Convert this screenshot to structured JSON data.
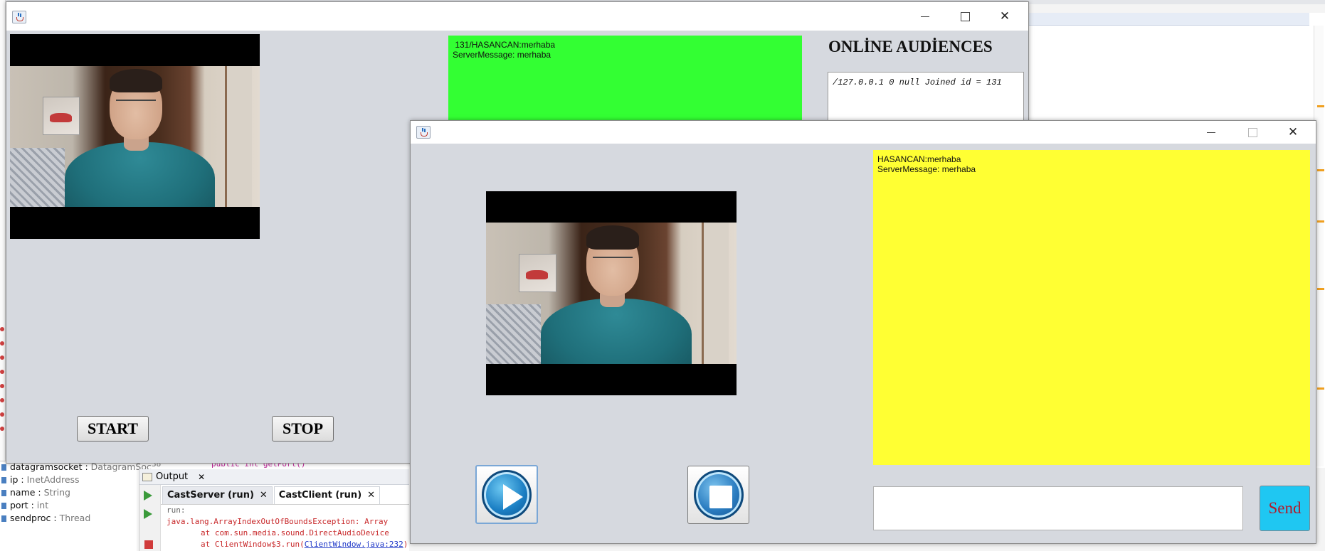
{
  "ide": {
    "code_line_number": "38",
    "code_line_text": "public int getPort()",
    "navigator": [
      {
        "name": "datagramsocket",
        "type": "DatagramSoc"
      },
      {
        "name": "ip",
        "type": "InetAddress"
      },
      {
        "name": "name",
        "type": "String"
      },
      {
        "name": "port",
        "type": "int"
      },
      {
        "name": "sendproc",
        "type": "Thread"
      }
    ],
    "output": {
      "title": "Output",
      "close": "✕",
      "tabs": [
        {
          "label": "CastServer (run)",
          "close": "✕"
        },
        {
          "label": "CastClient (run)",
          "close": "✕"
        }
      ],
      "lines": {
        "run": "run:",
        "exception": "java.lang.ArrayIndexOutOfBoundsException: Array",
        "at1": "at com.sun.media.sound.DirectAudioDevice",
        "at2_prefix": "at ClientWindow$3.run(",
        "at2_link": "ClientWindow.java:232",
        "at2_suffix": ")"
      }
    }
  },
  "server_window": {
    "chat_text": " 131/HASANCAN:merhaba\nServerMessage: merhaba",
    "chat_color": "#33ff33",
    "audience_title": "ONLİNE AUDİENCES",
    "audience_entries": "/127.0.0.1 0 null Joined id = 131",
    "start_label": "START",
    "stop_label": "STOP",
    "close_glyph": "✕"
  },
  "client_window": {
    "chat_text": "HASANCAN:merhaba\nServerMessage: merhaba",
    "chat_color": "#ffff33",
    "message_value": "",
    "send_label": "Send",
    "send_color": "#1fc7f2",
    "close_glyph": "✕",
    "play_icon": "play-icon",
    "stop_icon": "stop-icon"
  }
}
